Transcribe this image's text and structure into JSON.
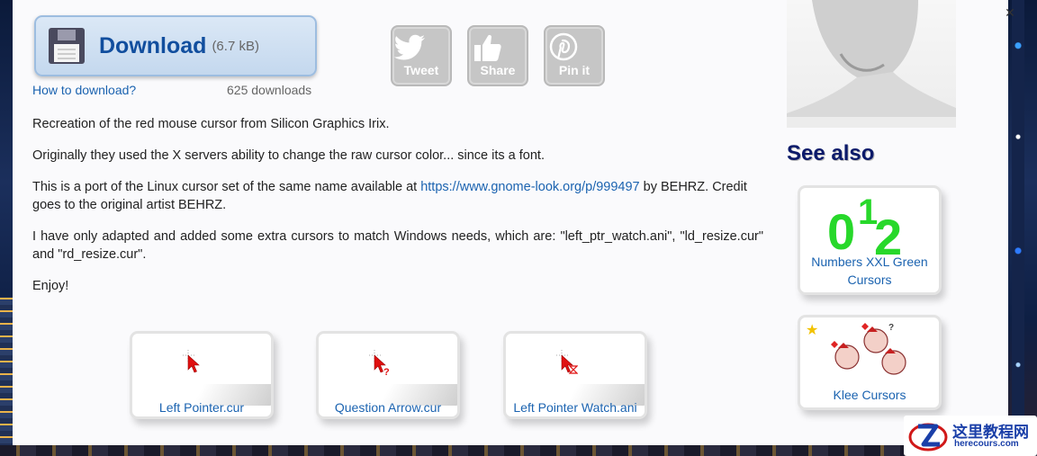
{
  "download": {
    "label": "Download",
    "size": "(6.7 kB)",
    "how_to": "How to download?",
    "count": "625 downloads"
  },
  "social": [
    {
      "label": "Tweet",
      "icon": "twitter-bird-icon"
    },
    {
      "label": "Share",
      "icon": "thumbs-up-icon"
    },
    {
      "label": "Pin it",
      "icon": "pinterest-icon"
    }
  ],
  "description": {
    "p1": "Recreation of the red mouse cursor from Silicon Graphics Irix.",
    "p2": "Originally they used the X servers ability to change the raw cursor color... since its a font.",
    "p3_before": "This is a port of the Linux cursor set of the same name available at ",
    "p3_link": "https://www.gnome-look.org/p/999497",
    "p3_after": " by BEHRZ. Credit goes to the original artist BEHRZ.",
    "p4": "I have only adapted and added some extra cursors to match Windows needs, which are: \"left_ptr_watch.ani\", \"ld_resize.cur\" and \"rd_resize.cur\".",
    "p5": "Enjoy!"
  },
  "cursors": [
    {
      "name": "Left Pointer.cur"
    },
    {
      "name": "Question Arrow.cur"
    },
    {
      "name": "Left Pointer Watch.ani"
    }
  ],
  "see_also": {
    "title": "See also",
    "items": [
      {
        "name": "Numbers XXL Green Cursors",
        "thumb_text": "012"
      },
      {
        "name": "Klee Cursors"
      }
    ]
  },
  "watermark": {
    "title": "这里教程网",
    "url": "herecours.com"
  },
  "colors": {
    "link": "#1b63b0",
    "download_text": "#114e9e",
    "see_also": "#0b1a6a",
    "cursor_red": "#e01010",
    "green": "#27d82a"
  }
}
